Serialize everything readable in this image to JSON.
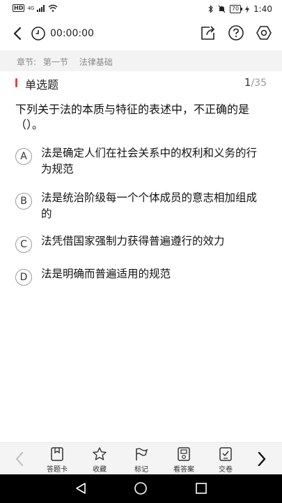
{
  "status_bar": {
    "network_badge": "HD",
    "network_type": "4G",
    "battery": "70",
    "time": "1:40"
  },
  "header": {
    "timer": "00:00:00",
    "icons": [
      "back-arrow-icon",
      "clock-icon",
      "share-icon",
      "help-icon",
      "settings-icon"
    ]
  },
  "chapter": {
    "prefix": "章节:",
    "section": "第一节",
    "topic": "法律基础"
  },
  "question_type": {
    "label": "单选题",
    "current": "1",
    "total": "/35"
  },
  "question": {
    "text": "下列关于法的本质与特征的表述中，不正确的是（）。"
  },
  "options": [
    {
      "letter": "A",
      "text": "法是确定人们在社会关系中的权利和义务的行为规范"
    },
    {
      "letter": "B",
      "text": "法是统治阶级每一个个体成员的意志相加组成的"
    },
    {
      "letter": "C",
      "text": "法凭借国家强制力获得普遍遵行的效力"
    },
    {
      "letter": "D",
      "text": "法是明确而普遍适用的规范"
    }
  ],
  "toolbar": {
    "answer_sheet": "答题卡",
    "favorite": "收藏",
    "mark": "标记",
    "view_answer": "看答案",
    "submit": "交卷"
  },
  "colors": {
    "accent_red": "#e8413b",
    "chapter_bg": "#f3f3f3",
    "toolbar_bg": "#f4f4f4"
  }
}
